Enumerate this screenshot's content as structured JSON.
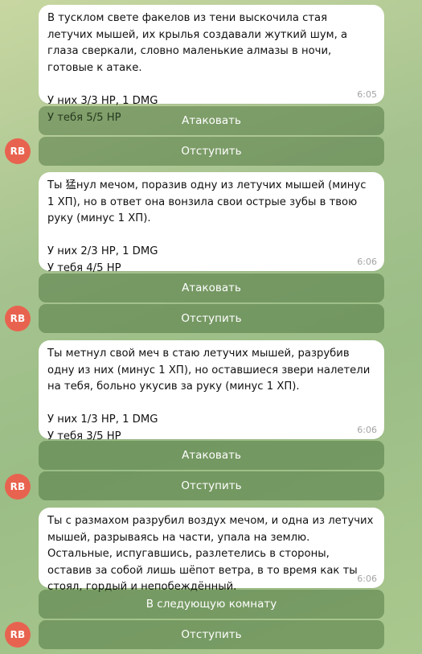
{
  "colors": {
    "avatar_bg": "#e8634f",
    "bubble_bg": "#ffffff",
    "button_bg": "#5d8a4c"
  },
  "messages": [
    {
      "text": "В тусклом свете факелов из тени выскочила стая летучих мышей, их крылья создавали жуткий шум, а глаза сверкали, словно маленькие алмазы в ночи, готовые к атаке.\n\nУ них 3/3 HP, 1 DMG\nУ тебя 5/5 HP",
      "time": "6:05",
      "buttons": [
        "Атаковать",
        "Отступить"
      ],
      "avatar": "RB"
    },
    {
      "text": "Ты 猛нул мечом, поразив одну из летучих мышей (минус 1 ХП), но в ответ она вонзила свои острые зубы в твою руку (минус 1 ХП).\n\nУ них 2/3 HP, 1 DMG\nУ тебя 4/5 HP",
      "time": "6:06",
      "buttons": [
        "Атаковать",
        "Отступить"
      ],
      "avatar": "RB"
    },
    {
      "text": "Ты метнул свой меч в стаю летучих мышей, разрубив одну из них (минус 1 ХП), но оставшиеся звери налетели на тебя, больно укусив за руку (минус 1 ХП).\n\nУ них 1/3 HP, 1 DMG\nУ тебя 3/5 HP",
      "time": "6:06",
      "buttons": [
        "Атаковать",
        "Отступить"
      ],
      "avatar": "RB"
    },
    {
      "text": "Ты с размахом разрубил воздух мечом, и одна из летучих мышей, разрываясь на части, упала на землю. Остальные, испугавшись, разлетелись в стороны, оставив за собой лишь шёпот ветра, в то время как ты стоял, гордый и непобеждённый.",
      "time": "6:06",
      "buttons": [
        "В следующую комнату",
        "Отступить"
      ],
      "avatar": "RB"
    }
  ]
}
